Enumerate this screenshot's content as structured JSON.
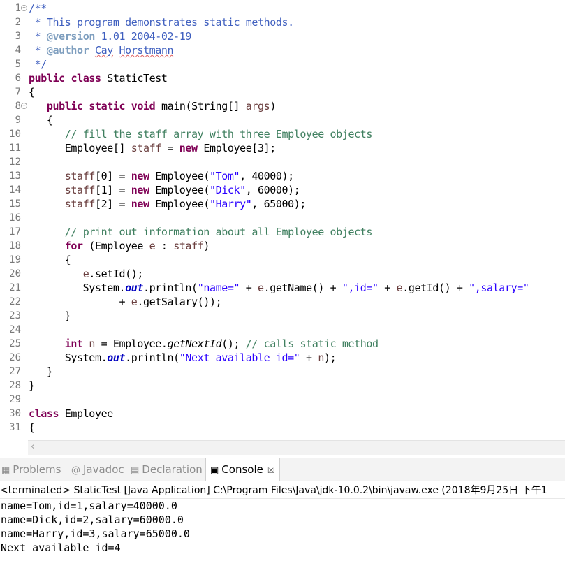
{
  "editor": {
    "lines": [
      [
        {
          "c": "t-doc",
          "t": "/**"
        }
      ],
      [
        {
          "c": "t-doc",
          "t": " * This program demonstrates static methods."
        }
      ],
      [
        {
          "c": "t-doc",
          "t": " * "
        },
        {
          "c": "t-tag",
          "t": "@version"
        },
        {
          "c": "t-doc",
          "t": " 1.01 2004-02-19"
        }
      ],
      [
        {
          "c": "t-doc",
          "t": " * "
        },
        {
          "c": "t-tag",
          "t": "@author"
        },
        {
          "c": "t-doc",
          "t": " "
        },
        {
          "c": "t-doc t-spell",
          "t": "Cay"
        },
        {
          "c": "t-doc",
          "t": " "
        },
        {
          "c": "t-doc t-spell",
          "t": "Horstmann"
        }
      ],
      [
        {
          "c": "t-doc",
          "t": " */"
        }
      ],
      [
        {
          "c": "t-kw",
          "t": "public"
        },
        {
          "c": "",
          "t": " "
        },
        {
          "c": "t-kw",
          "t": "class"
        },
        {
          "c": "",
          "t": " StaticTest"
        }
      ],
      [
        {
          "c": "",
          "t": "{"
        }
      ],
      [
        {
          "c": "",
          "t": "   "
        },
        {
          "c": "t-kw",
          "t": "public"
        },
        {
          "c": "",
          "t": " "
        },
        {
          "c": "t-kw",
          "t": "static"
        },
        {
          "c": "",
          "t": " "
        },
        {
          "c": "t-kw",
          "t": "void"
        },
        {
          "c": "",
          "t": " main(String[] "
        },
        {
          "c": "t-var",
          "t": "args"
        },
        {
          "c": "",
          "t": ")"
        }
      ],
      [
        {
          "c": "",
          "t": "   {"
        }
      ],
      [
        {
          "c": "",
          "t": "      "
        },
        {
          "c": "t-comment",
          "t": "// fill the staff array with three Employee objects"
        }
      ],
      [
        {
          "c": "",
          "t": "      Employee[] "
        },
        {
          "c": "t-var",
          "t": "staff"
        },
        {
          "c": "",
          "t": " = "
        },
        {
          "c": "t-kw",
          "t": "new"
        },
        {
          "c": "",
          "t": " Employee[3];"
        }
      ],
      [
        {
          "c": "",
          "t": ""
        }
      ],
      [
        {
          "c": "",
          "t": "      "
        },
        {
          "c": "t-var",
          "t": "staff"
        },
        {
          "c": "",
          "t": "[0] = "
        },
        {
          "c": "t-kw",
          "t": "new"
        },
        {
          "c": "",
          "t": " Employee("
        },
        {
          "c": "t-str",
          "t": "\"Tom\""
        },
        {
          "c": "",
          "t": ", 40000);"
        }
      ],
      [
        {
          "c": "",
          "t": "      "
        },
        {
          "c": "t-var",
          "t": "staff"
        },
        {
          "c": "",
          "t": "[1] = "
        },
        {
          "c": "t-kw",
          "t": "new"
        },
        {
          "c": "",
          "t": " Employee("
        },
        {
          "c": "t-str",
          "t": "\"Dick\""
        },
        {
          "c": "",
          "t": ", 60000);"
        }
      ],
      [
        {
          "c": "",
          "t": "      "
        },
        {
          "c": "t-var",
          "t": "staff"
        },
        {
          "c": "",
          "t": "[2] = "
        },
        {
          "c": "t-kw",
          "t": "new"
        },
        {
          "c": "",
          "t": " Employee("
        },
        {
          "c": "t-str",
          "t": "\"Harry\""
        },
        {
          "c": "",
          "t": ", 65000);"
        }
      ],
      [
        {
          "c": "",
          "t": ""
        }
      ],
      [
        {
          "c": "",
          "t": "      "
        },
        {
          "c": "t-comment",
          "t": "// print out information about all Employee objects"
        }
      ],
      [
        {
          "c": "",
          "t": "      "
        },
        {
          "c": "t-kw",
          "t": "for"
        },
        {
          "c": "",
          "t": " (Employee "
        },
        {
          "c": "t-var",
          "t": "e"
        },
        {
          "c": "",
          "t": " : "
        },
        {
          "c": "t-var",
          "t": "staff"
        },
        {
          "c": "",
          "t": ")"
        }
      ],
      [
        {
          "c": "",
          "t": "      {"
        }
      ],
      [
        {
          "c": "",
          "t": "         "
        },
        {
          "c": "t-var",
          "t": "e"
        },
        {
          "c": "",
          "t": ".setId();"
        }
      ],
      [
        {
          "c": "",
          "t": "         System."
        },
        {
          "c": "t-field",
          "t": "out"
        },
        {
          "c": "",
          "t": ".println("
        },
        {
          "c": "t-str",
          "t": "\"name=\""
        },
        {
          "c": "",
          "t": " + "
        },
        {
          "c": "t-var",
          "t": "e"
        },
        {
          "c": "",
          "t": ".getName() + "
        },
        {
          "c": "t-str",
          "t": "\",id=\""
        },
        {
          "c": "",
          "t": " + "
        },
        {
          "c": "t-var",
          "t": "e"
        },
        {
          "c": "",
          "t": ".getId() + "
        },
        {
          "c": "t-str",
          "t": "\",salary=\""
        }
      ],
      [
        {
          "c": "",
          "t": "               + "
        },
        {
          "c": "t-var",
          "t": "e"
        },
        {
          "c": "",
          "t": ".getSalary());"
        }
      ],
      [
        {
          "c": "",
          "t": "      }"
        }
      ],
      [
        {
          "c": "",
          "t": ""
        }
      ],
      [
        {
          "c": "",
          "t": "      "
        },
        {
          "c": "t-kw",
          "t": "int"
        },
        {
          "c": "",
          "t": " "
        },
        {
          "c": "t-var",
          "t": "n"
        },
        {
          "c": "",
          "t": " = Employee."
        },
        {
          "c": "t-static",
          "t": "getNextId"
        },
        {
          "c": "",
          "t": "(); "
        },
        {
          "c": "t-comment",
          "t": "// calls static method"
        }
      ],
      [
        {
          "c": "",
          "t": "      System."
        },
        {
          "c": "t-field",
          "t": "out"
        },
        {
          "c": "",
          "t": ".println("
        },
        {
          "c": "t-str",
          "t": "\"Next available id=\""
        },
        {
          "c": "",
          "t": " + "
        },
        {
          "c": "t-var",
          "t": "n"
        },
        {
          "c": "",
          "t": ");"
        }
      ],
      [
        {
          "c": "",
          "t": "   }"
        }
      ],
      [
        {
          "c": "",
          "t": "}"
        }
      ],
      [
        {
          "c": "",
          "t": ""
        }
      ],
      [
        {
          "c": "t-kw",
          "t": "class"
        },
        {
          "c": "",
          "t": " Employee"
        }
      ],
      [
        {
          "c": "",
          "t": "{"
        }
      ]
    ],
    "folds": [
      1,
      8
    ]
  },
  "tabs": {
    "problems": "Problems",
    "javadoc": "Javadoc",
    "declaration": "Declaration",
    "console": "Console"
  },
  "console": {
    "header": "<terminated> StaticTest [Java Application] C:\\Program Files\\Java\\jdk-10.0.2\\bin\\javaw.exe (2018年9月25日 下午1",
    "output": [
      "name=Tom,id=1,salary=40000.0",
      "name=Dick,id=2,salary=60000.0",
      "name=Harry,id=3,salary=65000.0",
      "Next available id=4"
    ]
  }
}
